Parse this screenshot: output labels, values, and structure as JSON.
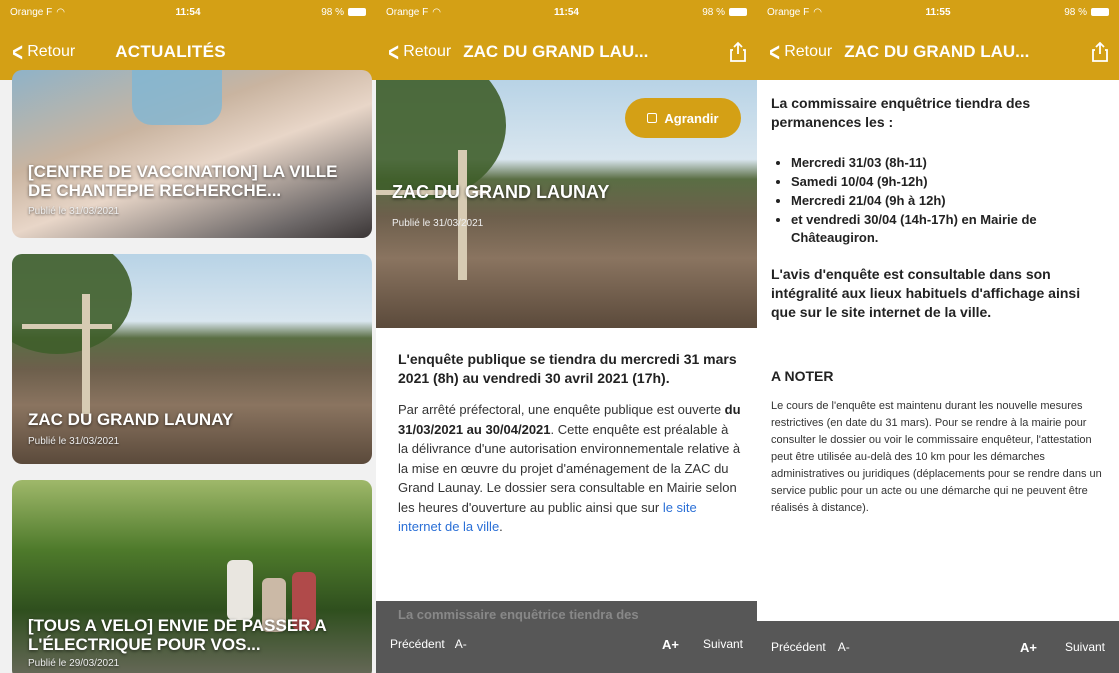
{
  "status_bars": [
    {
      "carrier": "Orange F",
      "time": "11:54",
      "battery": "98 %"
    },
    {
      "carrier": "Orange F",
      "time": "11:54",
      "battery": "98 %"
    },
    {
      "carrier": "Orange F",
      "time": "11:55",
      "battery": "98 %"
    }
  ],
  "colors": {
    "accent": "#d4a015",
    "toolbar": "#575757",
    "link": "#2a6fd6"
  },
  "screen1": {
    "back_label": "Retour",
    "title": "ACTUALITÉS",
    "cards": [
      {
        "title": "[CENTRE DE VACCINATION] LA VILLE DE CHANTEPIE RECHERCHE...",
        "date": "Publié le 31/03/2021"
      },
      {
        "title": "ZAC DU GRAND LAUNAY",
        "date": "Publié le 31/03/2021"
      },
      {
        "title": "[TOUS A VELO] ENVIE DE PASSER A L'ÉLECTRIQUE POUR VOS...",
        "date": "Publié le 29/03/2021"
      }
    ]
  },
  "screen2": {
    "back_label": "Retour",
    "title": "ZAC DU GRAND LAU...",
    "share_icon": "share-icon",
    "agrandir_label": "Agrandir",
    "hero_title": "ZAC DU GRAND LAUNAY",
    "hero_date": "Publié le 31/03/2021",
    "lead": "L'enquête publique se tiendra du mercredi 31 mars 2021 (8h) au vendredi 30 avril 2021 (17h).",
    "body_1": "Par arrêté préfectoral, une enquête publique est ouverte ",
    "body_bold": "du 31/03/2021 au 30/04/2021",
    "body_2": ". Cette enquête est préalable à la délivrance d'une autorisation environnementale relative à la mise en œuvre du projet d'aménagement de la ZAC du Grand Launay. Le dossier sera consultable en Mairie selon les heures d'ouverture au public ainsi que sur ",
    "link_text": "le site internet de la ville",
    "body_3": ".",
    "ghost_text": "La commissaire enquêtrice tiendra des",
    "toolbar": {
      "prev": "Précédent",
      "a_minus": "A-",
      "a_plus": "A+",
      "next": "Suivant"
    }
  },
  "screen3": {
    "back_label": "Retour",
    "title": "ZAC DU GRAND LAU...",
    "intro": "La commissaire enquêtrice tiendra des permanences les :",
    "permanences": [
      "Mercredi 31/03 (8h-11)",
      "Samedi 10/04 (9h-12h)",
      "Mercredi 21/04 (9h à 12h)",
      "et vendredi 30/04 (14h-17h) en Mairie de Châteaugiron."
    ],
    "avis": "L'avis d'enquête est consultable dans son intégralité aux lieux habituels d'affichage ainsi que sur le site internet de la ville.",
    "note_heading": "A NOTER",
    "note_text": "Le cours de l'enquête est maintenu durant les nouvelle mesures restrictives (en date du 31 mars). Pour se rendre à la mairie pour consulter le dossier ou voir le commissaire enquêteur, l'attestation peut être utilisée au-delà des 10 km pour les démarches administratives ou juridiques (déplacements pour se rendre dans un service public pour un acte ou une démarche qui ne peuvent être réalisés à distance).",
    "toolbar": {
      "prev": "Précédent",
      "a_minus": "A-",
      "a_plus": "A+",
      "next": "Suivant"
    }
  }
}
